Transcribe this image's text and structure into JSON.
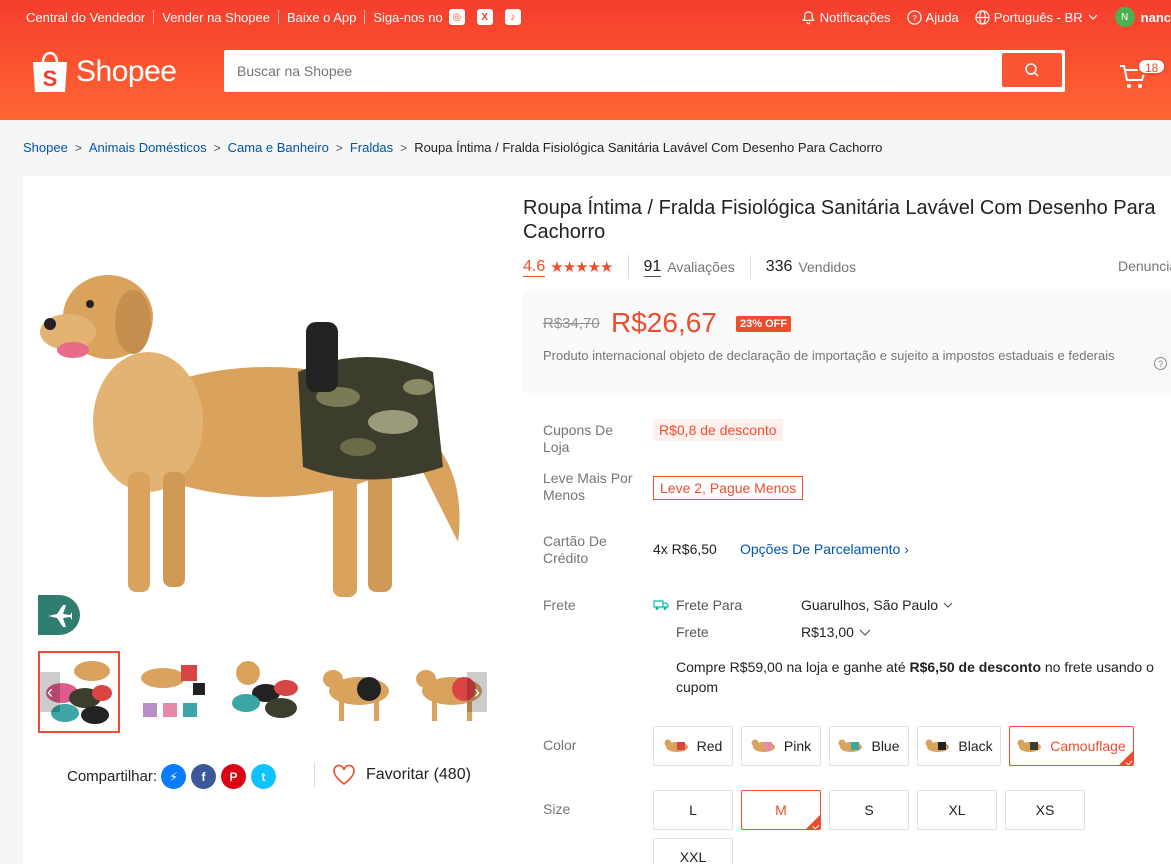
{
  "topbar": {
    "links": [
      "Central do Vendedor",
      "Vender na Shopee",
      "Baixe o App",
      "Siga-nos no"
    ],
    "notifications": "Notificações",
    "help": "Ajuda",
    "language": "Português - BR",
    "avatar_initial": "N",
    "username": "nanc"
  },
  "logo": {
    "text": "Shopee"
  },
  "search": {
    "placeholder": "Buscar na Shopee"
  },
  "cart": {
    "count": "18"
  },
  "breadcrumb": {
    "items": [
      "Shopee",
      "Animais Domésticos",
      "Cama e Banheiro",
      "Fraldas"
    ],
    "current": "Roupa Íntima / Fralda Fisiológica Sanitária Lavável Com Desenho Para Cachorro"
  },
  "product": {
    "title": "Roupa Íntima / Fralda Fisiológica Sanitária Lavável Com Desenho Para Cachorro",
    "rating": "4.6",
    "stars": "★★★★★",
    "reviews_count": "91",
    "reviews_label": "Avaliações",
    "sold_count": "336",
    "sold_label": "Vendidos",
    "report": "Denunciar",
    "old_price": "R$34,70",
    "price": "R$26,67",
    "discount": "23% OFF",
    "tax_note": "Produto internacional objeto de declaração de importação e sujeito a impostos estaduais e federais"
  },
  "details": {
    "coupons_label": "Cupons De Loja",
    "coupon": "R$0,8 de desconto",
    "bundle_label": "Leve Mais Por Menos",
    "bundle": "Leve 2, Pague Menos",
    "card_label": "Cartão De Crédito",
    "installment": "4x R$6,50",
    "installment_options": "Opções De Parcelamento",
    "shipping_label": "Frete",
    "ship_to_label": "Frete Para",
    "ship_to": "Guarulhos, São Paulo",
    "ship_fee_label": "Frete",
    "ship_fee": "R$13,00",
    "ship_note_a": "Compre R$59,00 na loja e ganhe até ",
    "ship_note_b": "R$6,50 de desconto",
    "ship_note_c": " no frete usando o cupom",
    "color_label": "Color",
    "size_label": "Size"
  },
  "colors": [
    "Red",
    "Pink",
    "Blue",
    "Black",
    "Camouflage"
  ],
  "selected_color": "Camouflage",
  "sizes": [
    "L",
    "M",
    "S",
    "XL",
    "XS",
    "XXL"
  ],
  "selected_size": "M",
  "share": {
    "label": "Compartilhar:"
  },
  "favorite": {
    "label": "Favoritar (480)"
  },
  "colors_hex": {
    "brand": "#ee4d2d",
    "link": "#0055aa"
  }
}
